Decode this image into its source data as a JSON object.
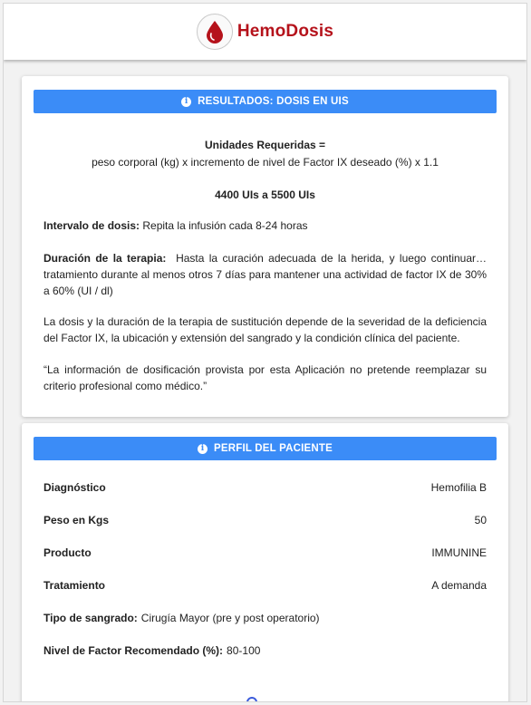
{
  "app": {
    "brand": "HemoDosis",
    "brand_color": "#b5121b",
    "logo_icon": "blood-drop-icon"
  },
  "results": {
    "header": "RESULTADOS: DOSIS EN UIS",
    "header_icon": "info-icon",
    "formula_title": "Unidades Requeridas =",
    "formula": "peso corporal (kg) x incremento de nivel de Factor IX deseado (%) x 1.1",
    "dose_range": "4400 UIs a 5500 UIs",
    "interval_label": "Intervalo de dosis:",
    "interval_text": "Repita la infusión cada 8-24 horas",
    "duration_label": "Duración de la terapia:",
    "duration_text": "Hasta la curación adecuada de la herida, y luego continuar… tratamiento durante al menos otros 7 días para mantener una actividad de factor IX de 30% a 60% (UI / dl)",
    "dosis_note": "La dosis y la duración de la terapia de sustitución depende de la severidad de la deficiencia del Factor IX, la ubicación y extensión del sangrado y la condición clínica del paciente.",
    "disclaimer": "“La información de dosificación provista por esta Aplicación no pretende reemplazar su criterio profesional como médico.”"
  },
  "profile": {
    "header": "PERFIL DEL PACIENTE",
    "header_icon": "info-icon",
    "rows": [
      {
        "label": "Diagnóstico",
        "value": "Hemofilia B"
      },
      {
        "label": "Peso en Kgs",
        "value": "50"
      },
      {
        "label": "Producto",
        "value": "IMMUNINE"
      },
      {
        "label": "Tratamiento",
        "value": "A demanda"
      },
      {
        "label": "Tipo de sangrado:",
        "value": "Cirugía Mayor (pre y post operatorio)"
      },
      {
        "label": "Nivel de Factor Recomendado (%):",
        "value": "80-100"
      }
    ]
  },
  "theme": {
    "accent": "#3b8cf7"
  }
}
